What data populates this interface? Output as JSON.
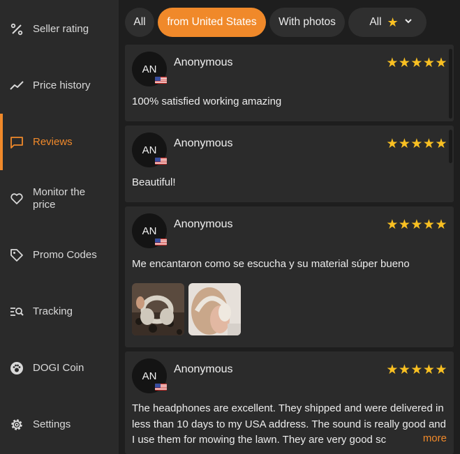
{
  "sidebar": {
    "items": [
      {
        "label": "Seller rating",
        "icon": "percent-icon"
      },
      {
        "label": "Price history",
        "icon": "trend-line-icon"
      },
      {
        "label": "Reviews",
        "icon": "chat-bubble-icon",
        "active": true
      },
      {
        "label": "Monitor the price",
        "icon": "heart-icon"
      },
      {
        "label": "Promo Codes",
        "icon": "tag-icon"
      },
      {
        "label": "Tracking",
        "icon": "tracking-search-icon"
      },
      {
        "label": "DOGI Coin",
        "icon": "paw-coin-icon"
      },
      {
        "label": "Settings",
        "icon": "gear-icon"
      }
    ],
    "accent_color": "#f0892a"
  },
  "filters": {
    "all": "All",
    "country": "from United States",
    "photos": "With photos",
    "rating": "All",
    "rating_icon": "star-icon",
    "selected": "from United States"
  },
  "reviews": [
    {
      "avatar": "AN",
      "name": "Anonymous",
      "stars": "★★★★★",
      "rating": 5,
      "flag": "us-flag-icon",
      "text": "100% satisfied working amazing"
    },
    {
      "avatar": "AN",
      "name": "Anonymous",
      "stars": "★★★★★",
      "rating": 5,
      "flag": "us-flag-icon",
      "text": "Beautiful!"
    },
    {
      "avatar": "AN",
      "name": "Anonymous",
      "stars": "★★★★★",
      "rating": 5,
      "flag": "us-flag-icon",
      "text": "Me encantaron como se escucha y su material súper bueno",
      "photos": [
        "headphones-photo",
        "person-wearing-headphones-photo"
      ]
    },
    {
      "avatar": "AN",
      "name": "Anonymous",
      "stars": "★★★★★",
      "rating": 5,
      "flag": "us-flag-icon",
      "text": "The headphones are excellent. They shipped and were delivered in less than 10 days to my USA address. The sound is really good and I use them for mowing the lawn. They are very good sc",
      "more": "more"
    }
  ],
  "colors": {
    "star": "#f9c022",
    "accent": "#f0892a",
    "card": "#2b2b2b"
  }
}
